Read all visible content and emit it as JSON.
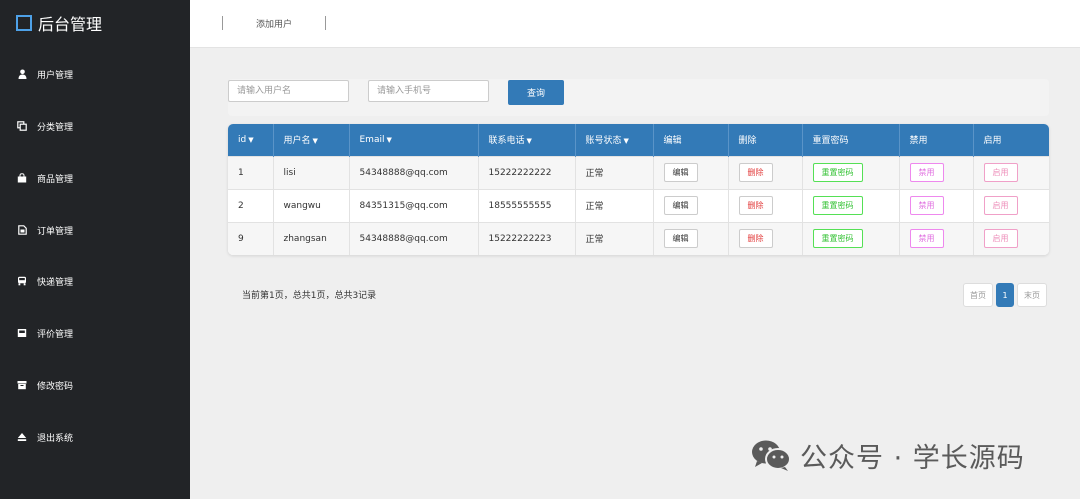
{
  "brand": {
    "title": "后台管理"
  },
  "sidebar": {
    "items": [
      {
        "label": "用户管理",
        "icon": "user-icon"
      },
      {
        "label": "分类管理",
        "icon": "copy-icon"
      },
      {
        "label": "商品管理",
        "icon": "shopping-bag-icon"
      },
      {
        "label": "订单管理",
        "icon": "document-icon"
      },
      {
        "label": "快递管理",
        "icon": "truck-icon"
      },
      {
        "label": "评价管理",
        "icon": "inbox-icon"
      },
      {
        "label": "修改密码",
        "icon": "archive-icon"
      },
      {
        "label": "退出系统",
        "icon": "eject-icon"
      }
    ]
  },
  "header": {
    "link": "添加用户"
  },
  "search": {
    "username_placeholder": "请输入用户名",
    "phone_placeholder": "请输入手机号",
    "button": "查询"
  },
  "table": {
    "headers": [
      "id",
      "用户名",
      "Email",
      "联系电话",
      "账号状态",
      "编辑",
      "删除",
      "重置密码",
      "禁用",
      "启用"
    ],
    "rows": [
      {
        "id": "1",
        "username": "lisi",
        "email": "54348888@qq.com",
        "phone": "15222222222",
        "status": "正常"
      },
      {
        "id": "2",
        "username": "wangwu",
        "email": "84351315@qq.com",
        "phone": "18555555555",
        "status": "正常"
      },
      {
        "id": "9",
        "username": "zhangsan",
        "email": "54348888@qq.com",
        "phone": "15222222223",
        "status": "正常"
      }
    ],
    "actions": {
      "edit": "编辑",
      "delete": "删除",
      "reset": "重置密码",
      "disable": "禁用",
      "enable": "启用"
    }
  },
  "pagination": {
    "info": "当前第1页，总共1页，总共3记录",
    "first": "首页",
    "current": "1",
    "last": "末页"
  },
  "watermark": {
    "text": "公众号 · 学长源码"
  },
  "colors": {
    "sidebar": "#222427",
    "accent": "#337ab7",
    "header_bg": "#ffffff",
    "content_bg": "#efefef"
  }
}
